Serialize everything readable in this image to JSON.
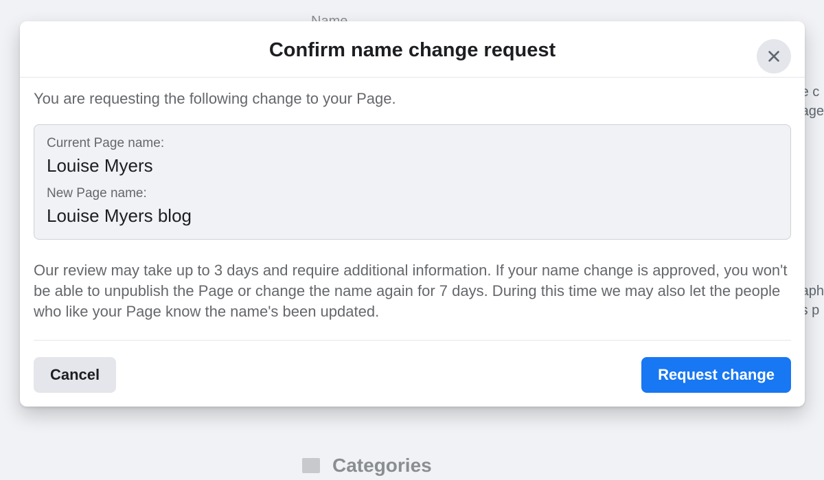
{
  "background": {
    "name_label": "Name",
    "categories_label": "Categories",
    "right_snippet_1a": "e c",
    "right_snippet_1b": "age",
    "right_snippet_2a": "aph",
    "right_snippet_2b": "s p"
  },
  "modal": {
    "title": "Confirm name change request",
    "intro": "You are requesting the following change to your Page.",
    "current_label": "Current Page name:",
    "current_value": "Louise Myers",
    "new_label": "New Page name:",
    "new_value": "Louise Myers blog",
    "review_text": "Our review may take up to 3 days and require additional information. If your name change is approved, you won't be able to unpublish the Page or change the name again for 7 days. During this time we may also let the people who like your Page know the name's been updated.",
    "cancel_label": "Cancel",
    "request_label": "Request change"
  }
}
